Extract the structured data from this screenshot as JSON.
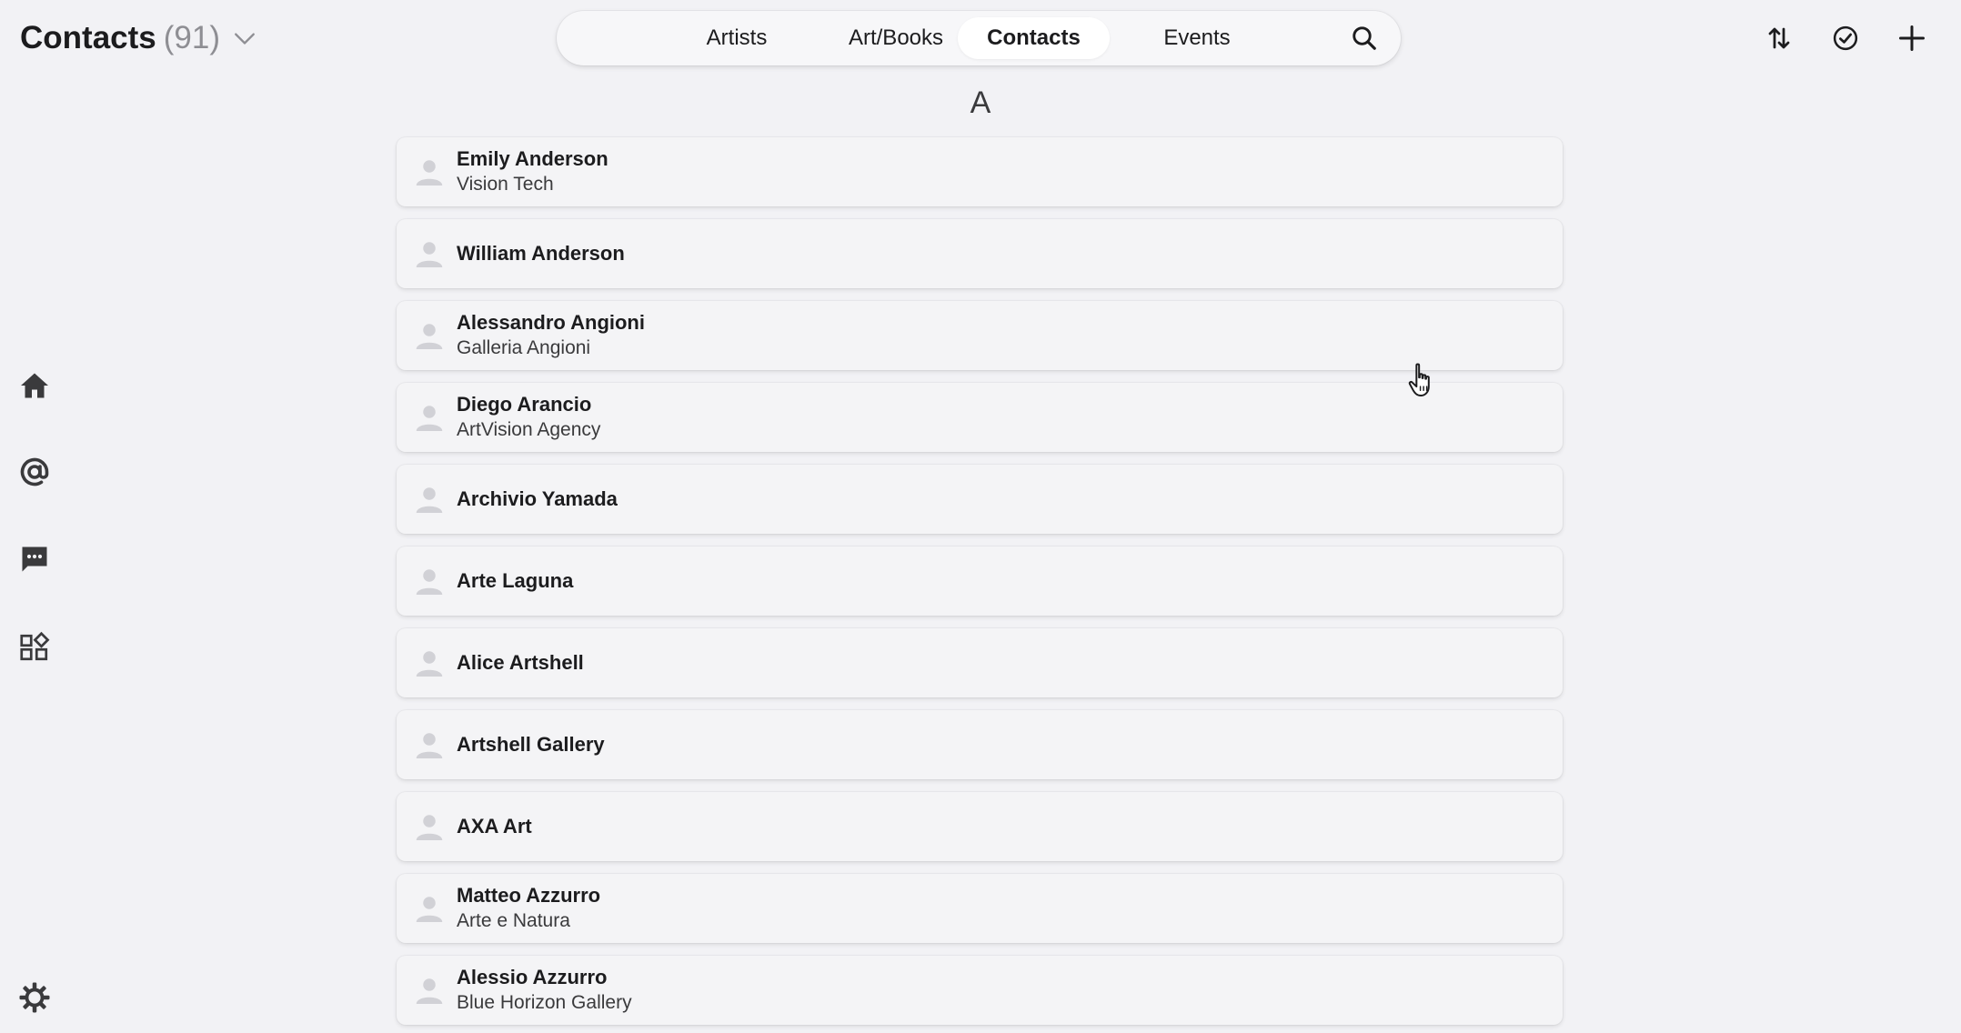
{
  "header": {
    "title": "Contacts",
    "count": "(91)"
  },
  "nav": {
    "tabs": [
      {
        "label": "Artists"
      },
      {
        "label": "Art/Books"
      },
      {
        "label": "Contacts",
        "active": true
      },
      {
        "label": "Events"
      }
    ],
    "search_icon": "search-icon"
  },
  "actions": {
    "sort_icon": "sort-arrows-icon",
    "select_icon": "check-circle-icon",
    "add_icon": "plus-icon"
  },
  "rail": {
    "items": [
      "home-icon",
      "at-sign-icon",
      "chat-icon",
      "widgets-icon"
    ],
    "settings_icon": "gear-icon"
  },
  "section": {
    "letter": "A"
  },
  "contacts": [
    {
      "name": "Emily Anderson",
      "org": "Vision Tech"
    },
    {
      "name": "William Anderson",
      "org": ""
    },
    {
      "name": "Alessandro Angioni",
      "org": "Galleria Angioni"
    },
    {
      "name": "Diego Arancio",
      "org": "ArtVision Agency"
    },
    {
      "name": "Archivio Yamada",
      "org": ""
    },
    {
      "name": "Arte Laguna",
      "org": ""
    },
    {
      "name": "Alice Artshell",
      "org": ""
    },
    {
      "name": "Artshell Gallery",
      "org": ""
    },
    {
      "name": "AXA Art",
      "org": ""
    },
    {
      "name": "Matteo Azzurro",
      "org": "Arte e Natura"
    },
    {
      "name": "Alessio Azzurro",
      "org": "Blue Horizon Gallery"
    }
  ],
  "colors": {
    "background": "#f2f2f5",
    "row": "#f4f4f6",
    "active_tab": "#ffffff",
    "icon": "#3a3a3c",
    "avatar": "#d1d1d6"
  }
}
